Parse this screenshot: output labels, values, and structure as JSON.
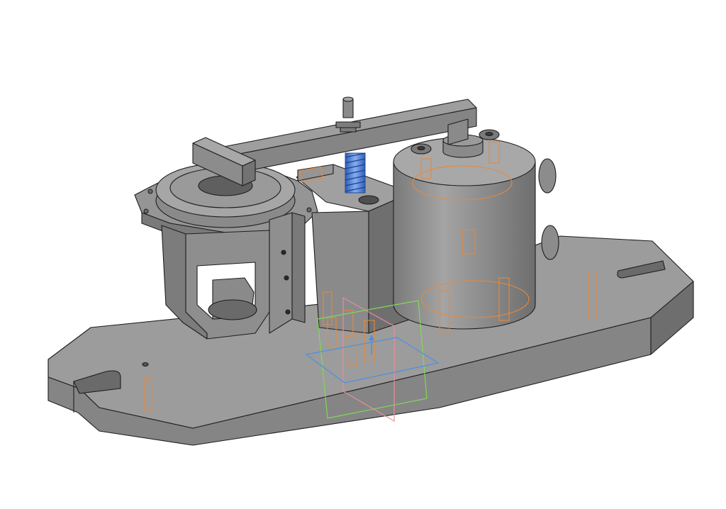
{
  "scene": {
    "background": "#ffffff",
    "part_colors": {
      "base_top": "#9c9c9c",
      "base_front": "#858585",
      "base_side": "#6e6e6e",
      "body_light": "#9a9a9a",
      "body_mid": "#858585",
      "body_dark": "#6c6c6c",
      "edge": "#1e1e1e"
    },
    "overlay_colors": {
      "hidden_pins": "#e8893a",
      "spring": "#4f7fd6",
      "plane_green": "#7ed957",
      "plane_pink": "#e98c9a",
      "plane_blue": "#4a90e2"
    },
    "icons": [
      "base-plate",
      "bracket-housing",
      "clamp-block",
      "cylinder-housing",
      "clamp-lever",
      "compression-spring",
      "datum-planes"
    ]
  }
}
